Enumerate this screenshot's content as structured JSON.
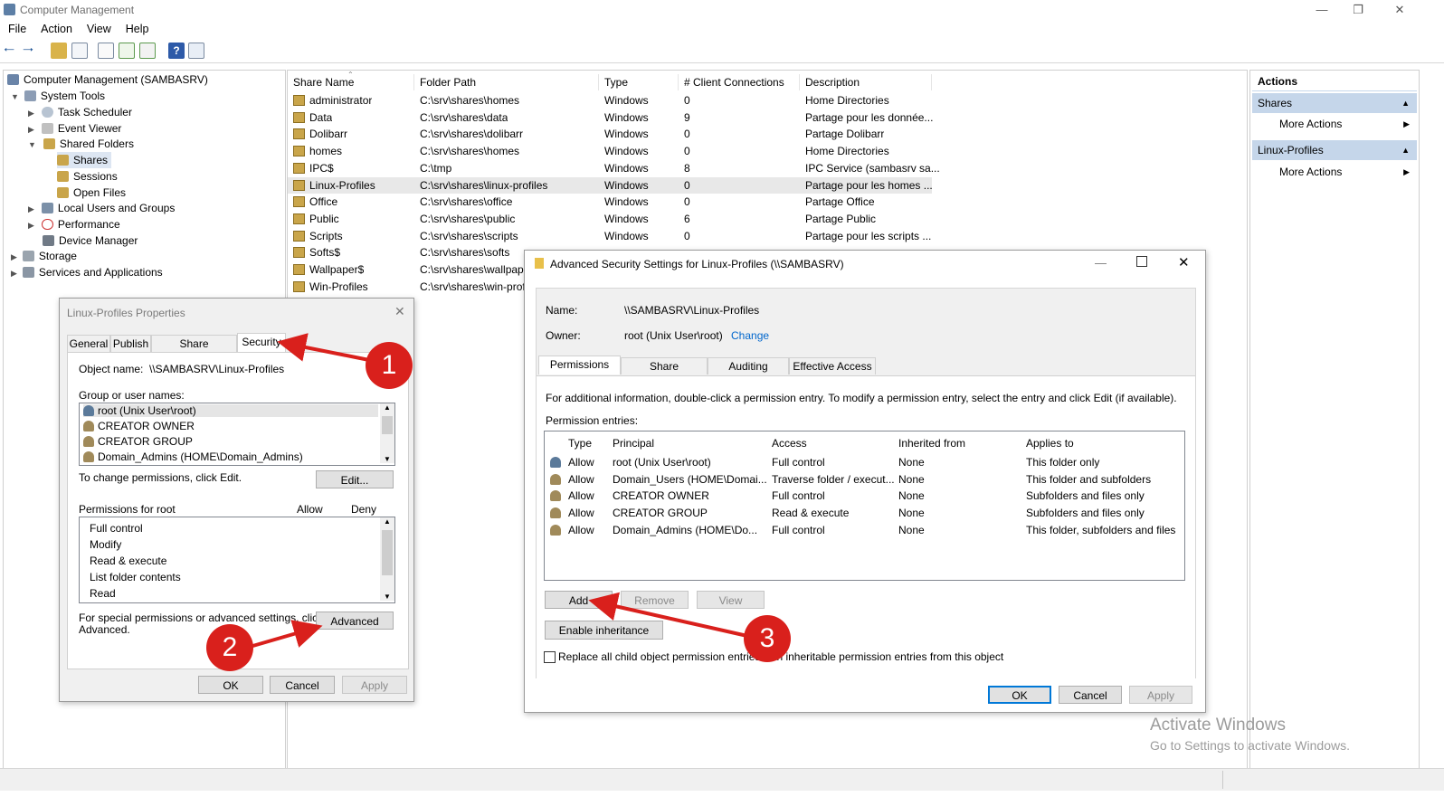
{
  "app": {
    "title": "Computer Management",
    "menu": [
      "File",
      "Action",
      "View",
      "Help"
    ]
  },
  "tree": {
    "root": "Computer Management (SAMBASRV)",
    "system_tools": "System Tools",
    "task_scheduler": "Task Scheduler",
    "event_viewer": "Event Viewer",
    "shared_folders": "Shared Folders",
    "shares": "Shares",
    "sessions": "Sessions",
    "open_files": "Open Files",
    "local_users": "Local Users and Groups",
    "performance": "Performance",
    "device_manager": "Device Manager",
    "storage": "Storage",
    "services": "Services and Applications"
  },
  "list": {
    "headers": [
      "Share Name",
      "Folder Path",
      "Type",
      "# Client Connections",
      "Description"
    ],
    "rows": [
      [
        "administrator",
        "C:\\srv\\shares\\homes",
        "Windows",
        "0",
        "Home Directories"
      ],
      [
        "Data",
        "C:\\srv\\shares\\data",
        "Windows",
        "9",
        "Partage pour les donnée..."
      ],
      [
        "Dolibarr",
        "C:\\srv\\shares\\dolibarr",
        "Windows",
        "0",
        "Partage Dolibarr"
      ],
      [
        "homes",
        "C:\\srv\\shares\\homes",
        "Windows",
        "0",
        "Home Directories"
      ],
      [
        "IPC$",
        "C:\\tmp",
        "Windows",
        "8",
        "IPC Service (sambasrv sa..."
      ],
      [
        "Linux-Profiles",
        "C:\\srv\\shares\\linux-profiles",
        "Windows",
        "0",
        "Partage pour les homes ..."
      ],
      [
        "Office",
        "C:\\srv\\shares\\office",
        "Windows",
        "0",
        "Partage Office"
      ],
      [
        "Public",
        "C:\\srv\\shares\\public",
        "Windows",
        "6",
        "Partage Public"
      ],
      [
        "Scripts",
        "C:\\srv\\shares\\scripts",
        "Windows",
        "0",
        "Partage pour les scripts ..."
      ],
      [
        "Softs$",
        "C:\\srv\\shares\\softs",
        "",
        "",
        ""
      ],
      [
        "Wallpaper$",
        "C:\\srv\\shares\\wallpape",
        "",
        "",
        ""
      ],
      [
        "Win-Profiles",
        "C:\\srv\\shares\\win-prof",
        "",
        "",
        ""
      ]
    ]
  },
  "actions": {
    "title": "Actions",
    "section1": "Shares",
    "more1": "More Actions",
    "section2": "Linux-Profiles",
    "more2": "More Actions"
  },
  "props": {
    "title": "Linux-Profiles Properties",
    "tabs": [
      "General",
      "Publish",
      "Share Permissions",
      "Security"
    ],
    "object_label": "Object name:",
    "object_value": "\\\\SAMBASRV\\Linux-Profiles",
    "group_label": "Group or user names:",
    "users": [
      "root (Unix User\\root)",
      "CREATOR OWNER",
      "CREATOR GROUP",
      "Domain_Admins (HOME\\Domain_Admins)"
    ],
    "change_text": "To change permissions, click Edit.",
    "edit": "Edit...",
    "perm_label": "Permissions for root",
    "allow": "Allow",
    "deny": "Deny",
    "perms": [
      "Full control",
      "Modify",
      "Read & execute",
      "List folder contents",
      "Read"
    ],
    "special_text1": "For special permissions or advanced settings, click",
    "special_text2": "Advanced.",
    "advanced": "Advanced",
    "ok": "OK",
    "cancel": "Cancel",
    "apply": "Apply"
  },
  "adv": {
    "title": "Advanced Security Settings for Linux-Profiles (\\\\SAMBASRV)",
    "name_label": "Name:",
    "name_value": "\\\\SAMBASRV\\Linux-Profiles",
    "owner_label": "Owner:",
    "owner_value": "root (Unix User\\root)",
    "change": "Change",
    "tabs": [
      "Permissions",
      "Share",
      "Auditing",
      "Effective Access"
    ],
    "info": "For additional information, double-click a permission entry. To modify a permission entry, select the entry and click Edit (if available).",
    "entries_label": "Permission entries:",
    "headers": [
      "Type",
      "Principal",
      "Access",
      "Inherited from",
      "Applies to"
    ],
    "entries": [
      [
        "Allow",
        "root (Unix User\\root)",
        "Full control",
        "None",
        "This folder only"
      ],
      [
        "Allow",
        "Domain_Users (HOME\\Domai...",
        "Traverse folder / execut...",
        "None",
        "This folder and subfolders"
      ],
      [
        "Allow",
        "CREATOR OWNER",
        "Full control",
        "None",
        "Subfolders and files only"
      ],
      [
        "Allow",
        "CREATOR GROUP",
        "Read & execute",
        "None",
        "Subfolders and files only"
      ],
      [
        "Allow",
        "Domain_Admins (HOME\\Do...",
        "Full control",
        "None",
        "This folder, subfolders and files"
      ]
    ],
    "add": "Add",
    "remove": "Remove",
    "view": "View",
    "enable_inheritance": "Enable inheritance",
    "replace_text": "Replace all child object permission entries with inheritable permission entries from this object",
    "ok": "OK",
    "cancel": "Cancel",
    "apply": "Apply"
  },
  "annotations": [
    "1",
    "2",
    "3"
  ],
  "watermark": {
    "line1": "Activate Windows",
    "line2": "Go to Settings to activate Windows."
  },
  "colors": {
    "annotation_red": "#d9201c",
    "link_blue": "#0066cc",
    "section_blue": "#c5d6ea"
  }
}
